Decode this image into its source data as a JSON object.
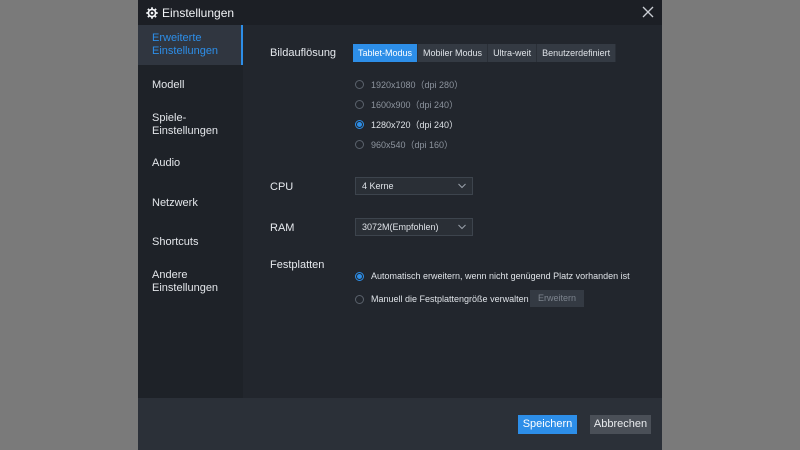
{
  "window": {
    "title": "Einstellungen",
    "icon": "gear-icon",
    "close_icon": "close-icon"
  },
  "sidebar": {
    "items": [
      {
        "label": "Erweiterte Einstellungen",
        "active": true
      },
      {
        "label": "Modell"
      },
      {
        "label": "Spiele-Einstellungen"
      },
      {
        "label": "Audio"
      },
      {
        "label": "Netzwerk"
      },
      {
        "label": "Shortcuts"
      },
      {
        "label": "Andere Einstellungen"
      }
    ]
  },
  "resolution": {
    "label": "Bildauflösung",
    "modes": [
      "Tablet-Modus",
      "Mobiler Modus",
      "Ultra-weit",
      "Benutzerdefiniert"
    ],
    "active_mode": "Tablet-Modus",
    "options": [
      "1920x1080（dpi 280）",
      "1600x900（dpi 240）",
      "1280x720（dpi 240）",
      "960x540（dpi 160）"
    ],
    "selected": "1280x720（dpi 240）"
  },
  "cpu": {
    "label": "CPU",
    "value": "4 Kerne"
  },
  "ram": {
    "label": "RAM",
    "value": "3072M(Empfohlen)"
  },
  "disk": {
    "label": "Festplatten",
    "option_auto": "Automatisch erweitern, wenn nicht genügend Platz vorhanden ist",
    "option_manual": "Manuell die Festplattengröße verwalten",
    "expand_button": "Erweitern",
    "selected": "auto"
  },
  "footer": {
    "save": "Speichern",
    "cancel": "Abbrechen"
  },
  "colors": {
    "accent": "#2d8ee8",
    "dialog_bg": "#22262d",
    "sidebar_bg": "#1e2228",
    "backdrop": "#7a7a7a"
  }
}
